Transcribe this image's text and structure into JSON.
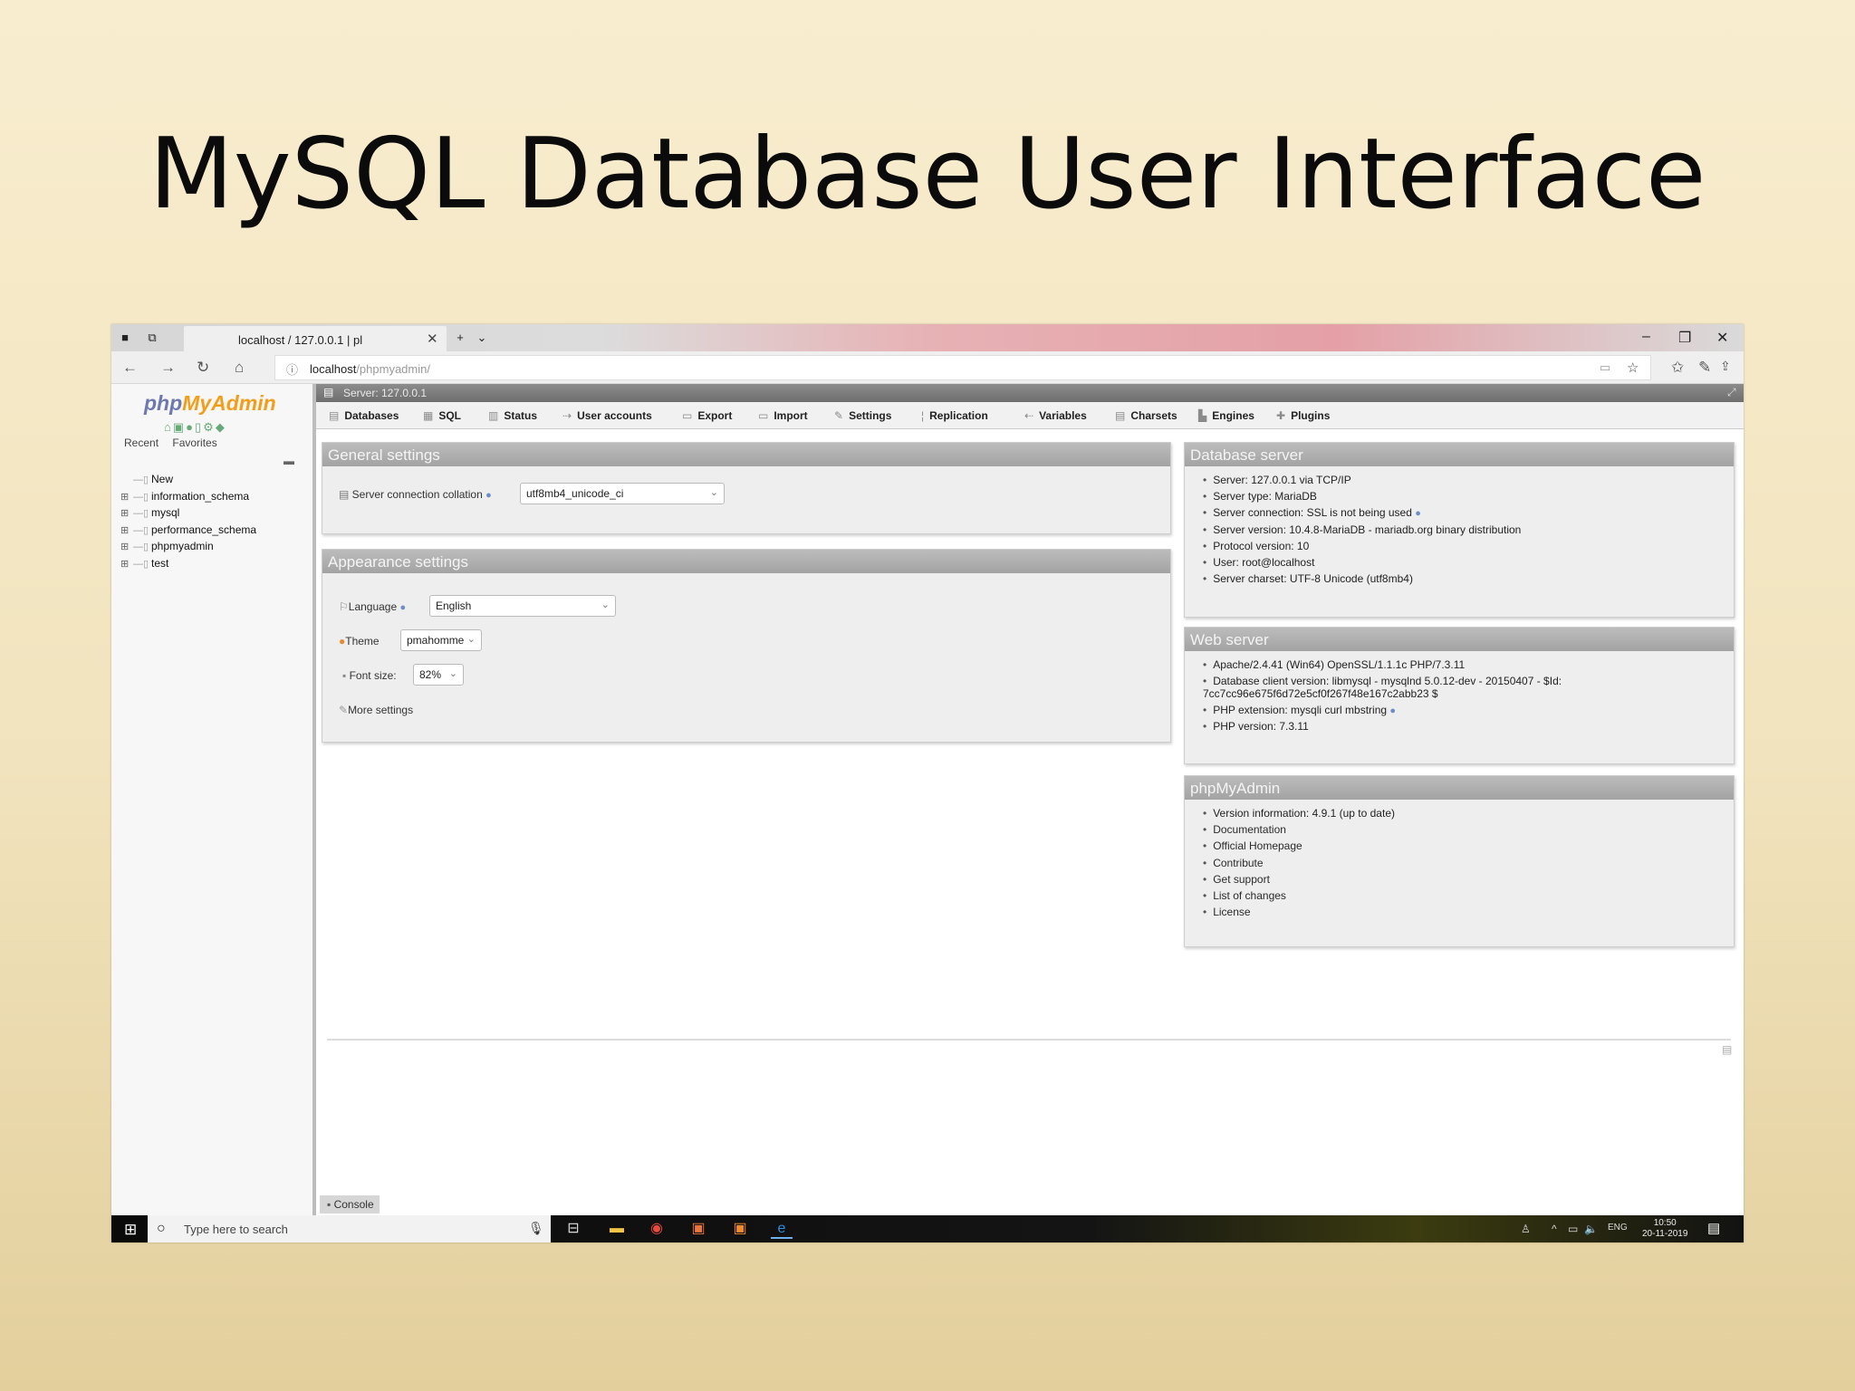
{
  "slide": {
    "title": "MySQL Database User Interface"
  },
  "browser": {
    "tab_title": "localhost / 127.0.0.1 | pl",
    "url_host": "localhost",
    "url_path": "/phpmyadmin/"
  },
  "sidebar": {
    "logo_php": "php",
    "logo_myadmin": "MyAdmin",
    "tabs": [
      "Recent",
      "Favorites"
    ],
    "tree": [
      "New",
      "information_schema",
      "mysql",
      "performance_schema",
      "phpmyadmin",
      "test"
    ]
  },
  "server_bar": {
    "label": "Server: 127.0.0.1"
  },
  "menu": [
    "Databases",
    "SQL",
    "Status",
    "User accounts",
    "Export",
    "Import",
    "Settings",
    "Replication",
    "Variables",
    "Charsets",
    "Engines",
    "Plugins"
  ],
  "general_settings": {
    "title": "General settings",
    "collation_label": "Server connection collation",
    "collation_value": "utf8mb4_unicode_ci"
  },
  "appearance_settings": {
    "title": "Appearance settings",
    "language_label": "Language",
    "language_value": "English",
    "theme_label": "Theme",
    "theme_value": "pmahomme",
    "fontsize_label": "Font size:",
    "fontsize_value": "82%",
    "more_settings": "More settings"
  },
  "database_server": {
    "title": "Database server",
    "items": [
      "Server: 127.0.0.1 via TCP/IP",
      "Server type: MariaDB",
      "Server connection: SSL is not being used",
      "Server version: 10.4.8-MariaDB - mariadb.org binary distribution",
      "Protocol version: 10",
      "User: root@localhost",
      "Server charset: UTF-8 Unicode (utf8mb4)"
    ]
  },
  "web_server": {
    "title": "Web server",
    "items": [
      "Apache/2.4.41 (Win64) OpenSSL/1.1.1c PHP/7.3.11",
      "Database client version: libmysql - mysqlnd 5.0.12-dev - 20150407 - $Id: 7cc7cc96e675f6d72e5cf0f267f48e167c2abb23 $",
      "PHP extension: mysqli curl mbstring",
      "PHP version: 7.3.11"
    ]
  },
  "phpmyadmin_panel": {
    "title": "phpMyAdmin",
    "items": [
      "Version information: 4.9.1 (up to date)",
      "Documentation",
      "Official Homepage",
      "Contribute",
      "Get support",
      "List of changes",
      "License"
    ]
  },
  "console": {
    "label": "Console"
  },
  "taskbar": {
    "search_placeholder": "Type here to search",
    "lang": "ENG",
    "time": "10:50",
    "date": "20-11-2019"
  },
  "colors": {
    "accent_logo_php": "#6c78af",
    "accent_logo_admin": "#f29e1a",
    "panel_header": "#a3a3a3"
  }
}
